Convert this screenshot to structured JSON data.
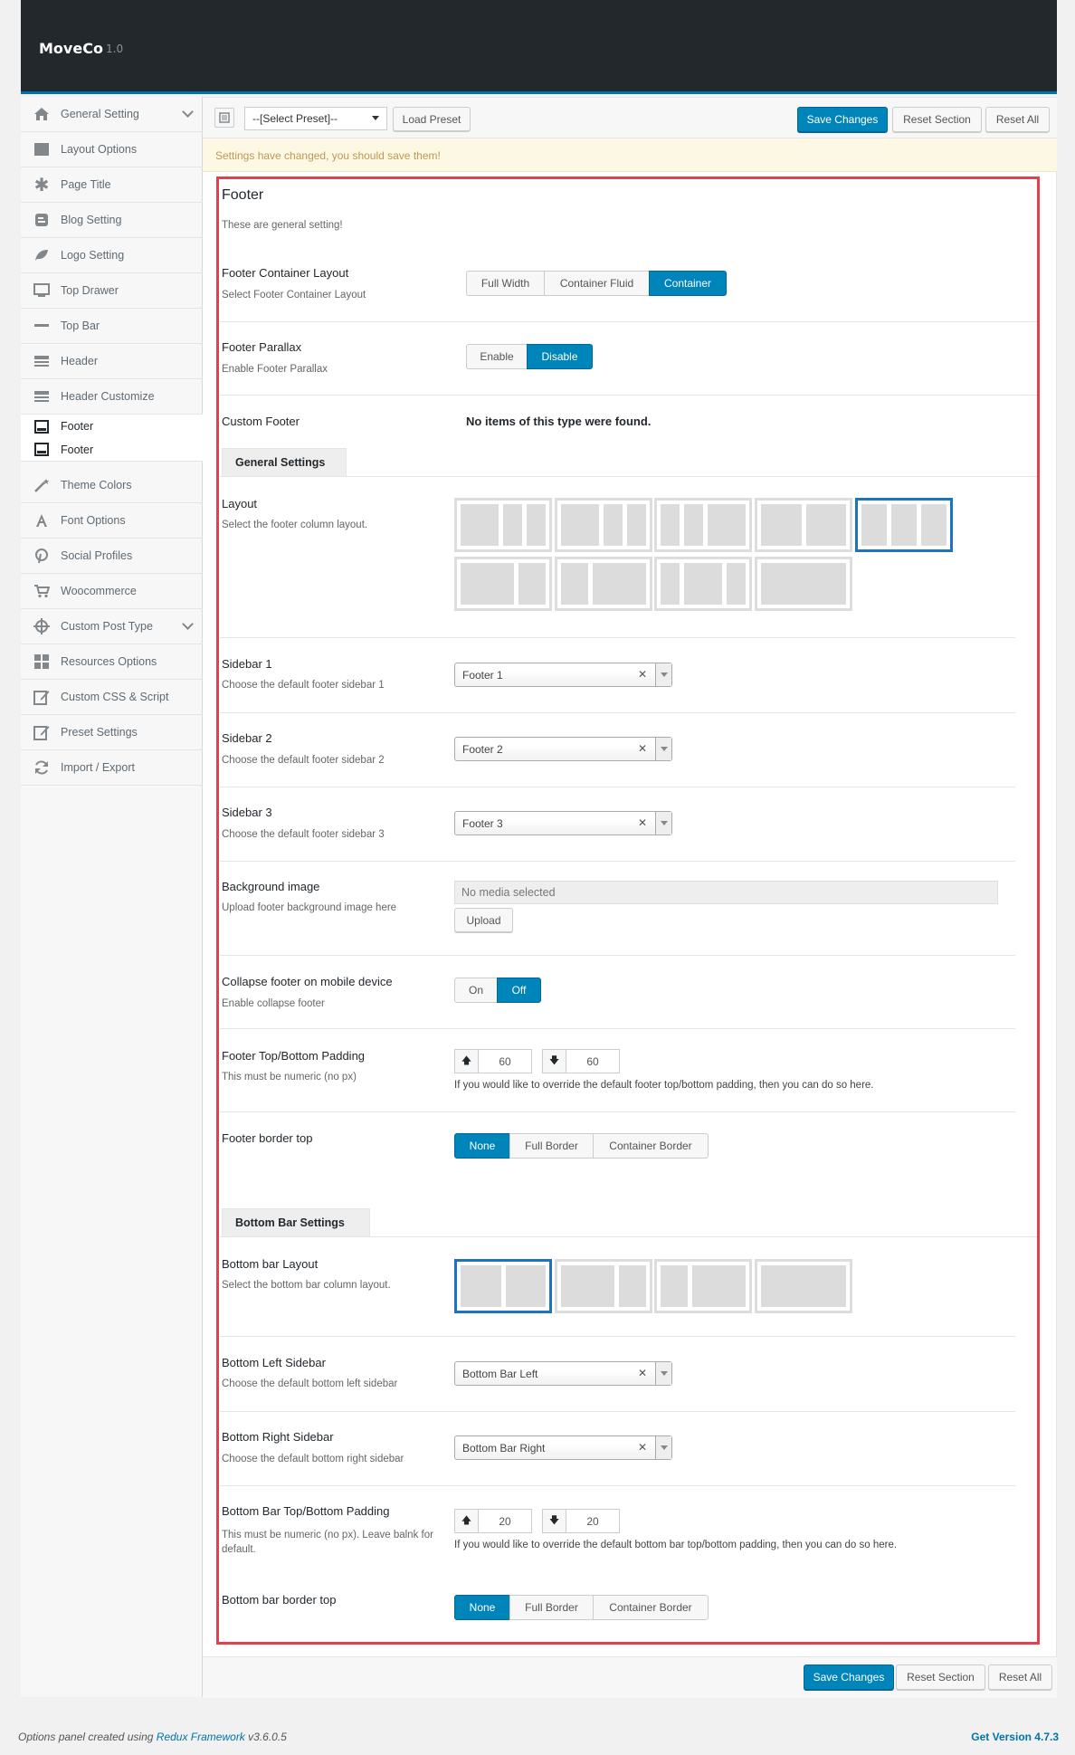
{
  "app": {
    "name": "MoveCo",
    "version": "1.0"
  },
  "sidebar": {
    "items": [
      {
        "label": "General Setting",
        "icon": "home-icon",
        "expandable": true
      },
      {
        "label": "Layout Options",
        "icon": "layout-icon"
      },
      {
        "label": "Page Title",
        "icon": "asterisk-icon"
      },
      {
        "label": "Blog Setting",
        "icon": "blog-icon"
      },
      {
        "label": "Logo Setting",
        "icon": "leaf-icon"
      },
      {
        "label": "Top Drawer",
        "icon": "monitor-icon"
      },
      {
        "label": "Top Bar",
        "icon": "minus-icon"
      },
      {
        "label": "Header",
        "icon": "header-icon"
      },
      {
        "label": "Header Customize",
        "icon": "header-customize-icon"
      },
      {
        "label": "Footer",
        "icon": "footer-icon"
      },
      {
        "label": "Footer",
        "icon": "footer-sub-icon"
      },
      {
        "label": "Theme Colors",
        "icon": "magic-wand-icon"
      },
      {
        "label": "Font Options",
        "icon": "font-icon"
      },
      {
        "label": "Social Profiles",
        "icon": "pinterest-icon"
      },
      {
        "label": "Woocommerce",
        "icon": "cart-icon"
      },
      {
        "label": "Custom Post Type",
        "icon": "crosshair-icon",
        "expandable": true
      },
      {
        "label": "Resources Options",
        "icon": "grid-icon"
      },
      {
        "label": "Custom CSS & Script",
        "icon": "edit-icon"
      },
      {
        "label": "Preset Settings",
        "icon": "edit-preset-icon"
      },
      {
        "label": "Import / Export",
        "icon": "refresh-icon"
      }
    ]
  },
  "toolbar": {
    "preset_select": "--[Select Preset]--",
    "load_preset": "Load Preset",
    "save_changes": "Save Changes",
    "reset_section": "Reset Section",
    "reset_all": "Reset All"
  },
  "notice": "Settings have changed, you should save them!",
  "section": {
    "title": "Footer",
    "description": "These are general setting!",
    "footer_container_layout": {
      "label": "Footer Container Layout",
      "desc": "Select Footer Container Layout",
      "options": [
        "Full Width",
        "Container Fluid",
        "Container"
      ],
      "selected": "Container"
    },
    "footer_parallax": {
      "label": "Footer Parallax",
      "desc": "Enable Footer Parallax",
      "options": [
        "Enable",
        "Disable"
      ],
      "selected": "Disable"
    },
    "custom_footer": {
      "label": "Custom Footer",
      "value": "No items of this type were found."
    },
    "general_tab": "General Settings",
    "layout": {
      "label": "Layout",
      "desc": "Select the footer column layout.",
      "selected_index": 4
    },
    "sidebar1": {
      "label": "Sidebar 1",
      "desc": "Choose the default footer sidebar 1",
      "value": "Footer 1"
    },
    "sidebar2": {
      "label": "Sidebar 2",
      "desc": "Choose the default footer sidebar 2",
      "value": "Footer 2"
    },
    "sidebar3": {
      "label": "Sidebar 3",
      "desc": "Choose the default footer sidebar 3",
      "value": "Footer 3"
    },
    "background_image": {
      "label": "Background image",
      "desc": "Upload footer background image here",
      "placeholder": "No media selected",
      "upload": "Upload"
    },
    "collapse": {
      "label": "Collapse footer on mobile device",
      "desc": "Enable collapse footer",
      "options": [
        "On",
        "Off"
      ],
      "selected": "Off"
    },
    "padding": {
      "label": "Footer Top/Bottom Padding",
      "desc": "This must be numeric (no px)",
      "top": "60",
      "bottom": "60",
      "help": "If you would like to override the default footer top/bottom padding, then you can do so here."
    },
    "border_top": {
      "label": "Footer border top",
      "options": [
        "None",
        "Full Border",
        "Container Border"
      ],
      "selected": "None"
    },
    "bottom_tab": "Bottom Bar Settings",
    "bottom_layout": {
      "label": "Bottom bar Layout",
      "desc": "Select the bottom bar column layout.",
      "selected_index": 0
    },
    "bottom_left": {
      "label": "Bottom Left Sidebar",
      "desc": "Choose the default bottom left sidebar",
      "value": "Bottom Bar Left"
    },
    "bottom_right": {
      "label": "Bottom Right Sidebar",
      "desc": "Choose the default bottom right sidebar",
      "value": "Bottom Bar Right"
    },
    "bottom_padding": {
      "label": "Bottom Bar Top/Bottom Padding",
      "desc": "This must be numeric (no px). Leave balnk for default.",
      "top": "20",
      "bottom": "20",
      "help": "If you would like to override the default bottom bar top/bottom padding, then you can do so here."
    },
    "bottom_border": {
      "label": "Bottom bar border top",
      "options": [
        "None",
        "Full Border",
        "Container Border"
      ],
      "selected": "None"
    }
  },
  "footer": {
    "created_prefix": "Options panel created using",
    "framework_link": "Redux Framework",
    "framework_version": "v3.6.0.5",
    "get_version": "Get Version 4.7.3"
  }
}
